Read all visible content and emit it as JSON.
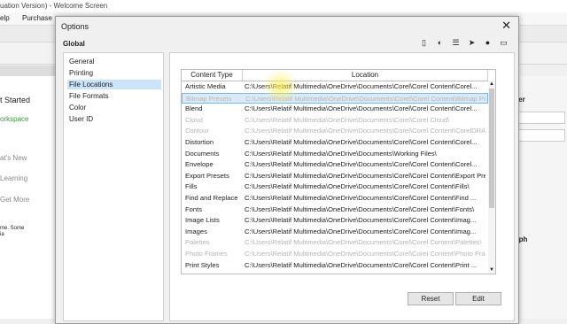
{
  "app": {
    "title_fragment": "uation Version) - Welcome Screen",
    "menu": [
      "elp",
      "Purchase"
    ]
  },
  "left_panel": {
    "items": [
      "t Started",
      "orkspace",
      "at's New",
      "Learning",
      "Get More",
      "me. Some",
      "ia"
    ]
  },
  "right_panel": {
    "label_top": "cter",
    "label_bottom": "raph"
  },
  "dialog": {
    "title": "Options",
    "close_icon": "close-icon",
    "section": "Global",
    "nav_items": [
      "General",
      "Printing",
      "File Locations",
      "File Formats",
      "Color",
      "User ID"
    ],
    "selected_nav": "File Locations",
    "toolbar_icons": [
      "page-icon",
      "color-wheel-icon",
      "sliders-icon",
      "pointer-icon",
      "pin-icon",
      "monitor-icon"
    ],
    "table": {
      "headers": [
        "Content Type",
        "Location"
      ],
      "rows": [
        {
          "type": "Artistic Media",
          "location": "C:\\Users\\Relatif Multimedia\\OneDrive\\Documents\\Corel\\Corel Content\\Corel...",
          "state": "normal"
        },
        {
          "type": "Bitmap Presets",
          "location": "C:\\Users\\Relatif Multimedia\\OneDrive\\Documents\\Corel\\Corel Content\\Bitmap Presets",
          "state": "selected"
        },
        {
          "type": "Blend",
          "location": "C:\\Users\\Relatif Multimedia\\OneDrive\\Documents\\Corel\\Corel Content\\Corel...",
          "state": "normal"
        },
        {
          "type": "Cloud",
          "location": "C:\\Users\\Relatif Multimedia\\OneDrive\\Documents\\Corel\\Corel Cloud\\",
          "state": "dim"
        },
        {
          "type": "Contour",
          "location": "C:\\Users\\Relatif Multimedia\\OneDrive\\Documents\\Corel\\Corel Content\\CorelDRAW\\Pre...",
          "state": "dim"
        },
        {
          "type": "Distortion",
          "location": "C:\\Users\\Relatif Multimedia\\OneDrive\\Documents\\Corel\\Corel Content\\Corel...",
          "state": "normal"
        },
        {
          "type": "Documents",
          "location": "C:\\Users\\Relatif Multimedia\\OneDrive\\Documents\\Working Files\\",
          "state": "normal"
        },
        {
          "type": "Envelope",
          "location": "C:\\Users\\Relatif Multimedia\\OneDrive\\Documents\\Corel\\Corel Content\\Corel...",
          "state": "normal"
        },
        {
          "type": "Export Presets",
          "location": "C:\\Users\\Relatif Multimedia\\OneDrive\\Documents\\Corel\\Corel Content\\Export Presets\\",
          "state": "normal"
        },
        {
          "type": "Fills",
          "location": "C:\\Users\\Relatif Multimedia\\OneDrive\\Documents\\Corel\\Corel Content\\Fills\\",
          "state": "normal"
        },
        {
          "type": "Find and Replace",
          "location": "C:\\Users\\Relatif Multimedia\\OneDrive\\Documents\\Corel\\Corel Content\\Find ...",
          "state": "normal"
        },
        {
          "type": "Fonts",
          "location": "C:\\Users\\Relatif Multimedia\\OneDrive\\Documents\\Corel\\Corel Content\\Fonts\\",
          "state": "normal"
        },
        {
          "type": "Image Lists",
          "location": "C:\\Users\\Relatif Multimedia\\OneDrive\\Documents\\Corel\\Corel Content\\Imag...",
          "state": "normal"
        },
        {
          "type": "Images",
          "location": "C:\\Users\\Relatif Multimedia\\OneDrive\\Documents\\Corel\\Corel Content\\Imag...",
          "state": "normal"
        },
        {
          "type": "Palettes",
          "location": "C:\\Users\\Relatif Multimedia\\OneDrive\\Documents\\Corel\\Corel Content\\Palettes\\",
          "state": "dim"
        },
        {
          "type": "Photo Frames",
          "location": "C:\\Users\\Relatif Multimedia\\OneDrive\\Documents\\Corel\\Corel Content\\Photo Frames\\",
          "state": "dim"
        },
        {
          "type": "Print Styles",
          "location": "C:\\Users\\Relatif Multimedia\\OneDrive\\Documents\\Corel\\Corel Content\\Print ...",
          "state": "normal"
        }
      ]
    },
    "buttons": {
      "reset": "Reset",
      "edit": "Edit"
    }
  },
  "colors": {
    "selection": "#cce4f7",
    "highlight": "#ffef50"
  }
}
